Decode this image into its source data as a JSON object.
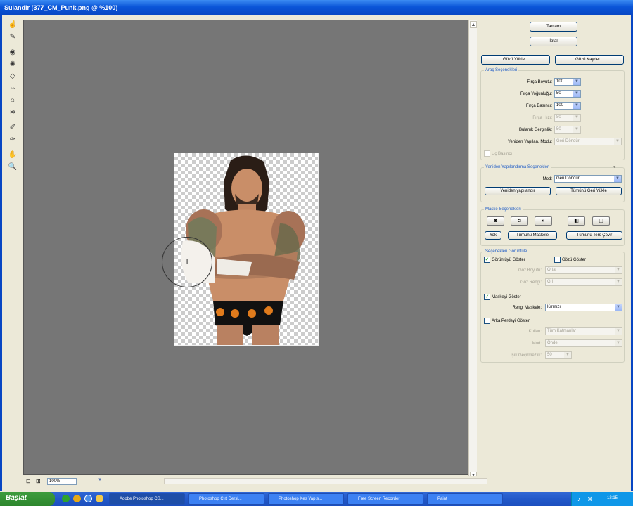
{
  "window": {
    "title": "Sulandir (377_CM_Punk.png @ %100)"
  },
  "tools": [
    "smudge-icon",
    "brush-icon",
    "stamp-icon",
    "fill-icon",
    "pattern-icon",
    "wand-icon",
    "clone-icon",
    "heal-icon",
    "dodge-icon",
    "burn-icon",
    "lasso-icon",
    "hand-icon",
    "zoom-icon"
  ],
  "status": {
    "zoom": "100%"
  },
  "buttons": {
    "ok": "Tamam",
    "cancel": "İptal",
    "load_mesh": "Gözü Yükle...",
    "save_mesh": "Gözü Kaydet..."
  },
  "tool_options": {
    "title": "Araç Seçenekleri",
    "rows": [
      {
        "label": "Fırça Boyutu:",
        "value": "100"
      },
      {
        "label": "Fırça Yoğunluğu:",
        "value": "50"
      },
      {
        "label": "Fırça Basıncı:",
        "value": "100"
      },
      {
        "label": "Fırça Hızı:",
        "value": "80"
      },
      {
        "label": "Bulanık Gerginlik:",
        "value": "50"
      }
    ],
    "rebuild_mode_label": "Yeniden Yapılan. Modu:",
    "rebuild_mode_value": "Geri Döndür",
    "stylus": "Uç Basıncı"
  },
  "rebuild": {
    "title": "Yeniden Yapılandırma Seçenekleri",
    "mode_label": "Mod:",
    "mode_value": "Geri Döndür",
    "rebuild_btn": "Yeniden yapılandır",
    "restore_all_btn": "Tümünü Geri Yükle"
  },
  "mask": {
    "title": "Maske Seçenekleri",
    "none_btn": "Yok",
    "mask_all_btn": "Tümünü Maskele",
    "invert_all_btn": "Tümünü Ters Çevir"
  },
  "view": {
    "title": "Seçenekleri Görüntüle",
    "show_image": "Görüntüyü Göster",
    "show_mesh": "Gözü Göster",
    "mesh_size_label": "Göz Boyutu:",
    "mesh_size_value": "Orta",
    "mesh_color_label": "Göz Rengi:",
    "mesh_color_value": "Gri",
    "show_mask": "Maskeyi Göster",
    "mask_color_label": "Rengi Maskele:",
    "mask_color_value": "Kırmızı",
    "show_backdrop": "Arka Perdeyi Göster",
    "use_label": "Kullan:",
    "use_value": "Tüm Katmanlar",
    "mode_label": "Mod:",
    "mode_value": "Önde",
    "opacity_label": "Işık Geçirmezlik:",
    "opacity_value": "50"
  },
  "taskbar": {
    "start": "Başlat",
    "tasks": [
      "Adobe Photoshop CS...",
      "Photoshop Cırt Dersl...",
      "Photoshop Kes Yapıs...",
      "Free Screen Recorder",
      "Paint"
    ],
    "clock": "12:15"
  }
}
